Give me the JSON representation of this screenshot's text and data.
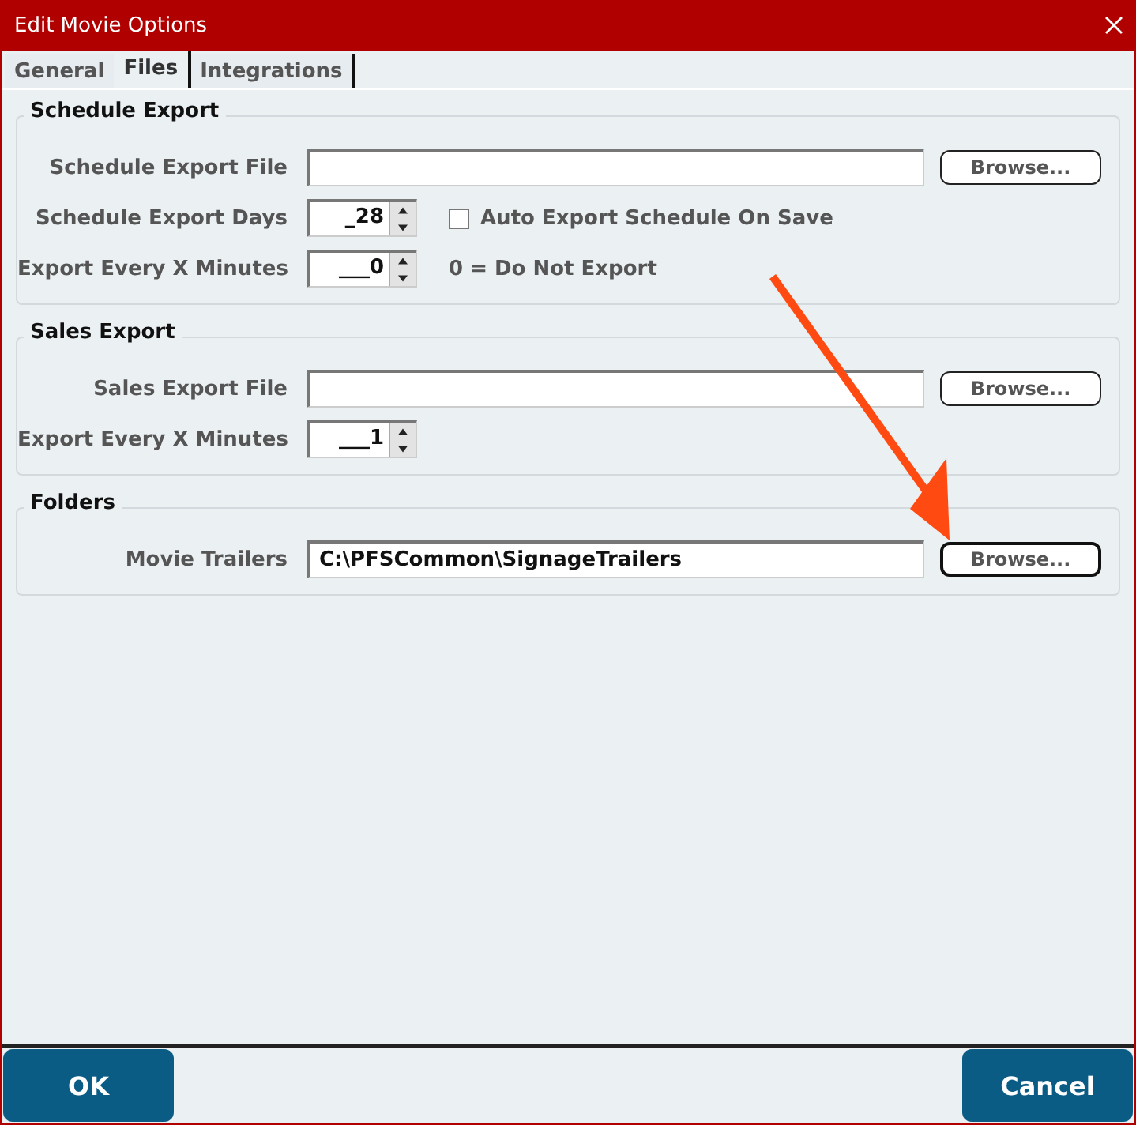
{
  "window": {
    "title": "Edit Movie Options"
  },
  "tabs": [
    {
      "label": "General",
      "selected": false
    },
    {
      "label": "Files",
      "selected": true
    },
    {
      "label": "Integrations",
      "selected": false
    }
  ],
  "groups": [
    {
      "title": "Schedule Export",
      "rows": [
        {
          "kind": "file",
          "label": "Schedule Export File",
          "value": "",
          "button": {
            "label": "Browse...",
            "focused": false
          }
        },
        {
          "kind": "spin",
          "label": "Schedule Export Days",
          "value": "_28",
          "checkbox": {
            "label": "Auto Export Schedule On Save",
            "checked": false
          }
        },
        {
          "kind": "spin",
          "label": "Export Every X Minutes",
          "value": "___0",
          "note": "0 = Do Not Export"
        }
      ]
    },
    {
      "title": "Sales Export",
      "rows": [
        {
          "kind": "file",
          "label": "Sales Export File",
          "value": "",
          "button": {
            "label": "Browse...",
            "focused": false
          }
        },
        {
          "kind": "spin",
          "label": "Export Every X Minutes",
          "value": "___1"
        }
      ]
    },
    {
      "title": "Folders",
      "rows": [
        {
          "kind": "file",
          "label": "Movie Trailers",
          "value": "C:\\PFSCommon\\SignageTrailers",
          "button": {
            "label": "Browse...",
            "focused": true
          }
        }
      ]
    }
  ],
  "buttons": [
    {
      "label": "OK"
    },
    {
      "label": "Cancel"
    }
  ]
}
